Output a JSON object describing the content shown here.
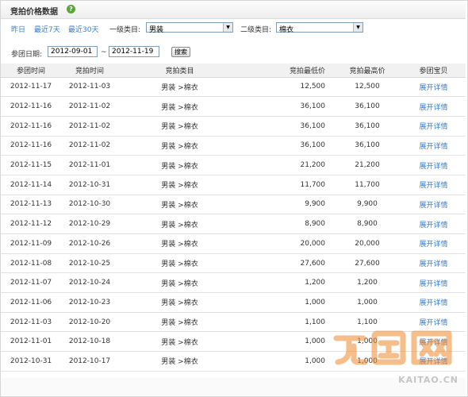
{
  "header": {
    "title": "竞拍价格数据",
    "help_icon": "?"
  },
  "filters": {
    "ranges": [
      "昨日",
      "最近7天",
      "最近30天"
    ],
    "level1_label": "一级类目:",
    "level1_value": "男装",
    "level2_label": "二级类目:",
    "level2_value": "棉衣",
    "date_label": "参团日期:",
    "date_from": "2012-09-01",
    "date_sep": "~",
    "date_to": "2012-11-19",
    "search_label": "搜索"
  },
  "table": {
    "columns": [
      "参团时间",
      "竞拍时间",
      "竞拍类目",
      "竞拍最低价",
      "竞拍最高价",
      "参团宝贝"
    ],
    "rows": [
      [
        "2012-11-17",
        "2012-11-03",
        "男装 >棉衣",
        "12,500",
        "12,500",
        "展开详情"
      ],
      [
        "2012-11-16",
        "2012-11-02",
        "男装 >棉衣",
        "36,100",
        "36,100",
        "展开详情"
      ],
      [
        "2012-11-16",
        "2012-11-02",
        "男装 >棉衣",
        "36,100",
        "36,100",
        "展开详情"
      ],
      [
        "2012-11-16",
        "2012-11-02",
        "男装 >棉衣",
        "36,100",
        "36,100",
        "展开详情"
      ],
      [
        "2012-11-15",
        "2012-11-01",
        "男装 >棉衣",
        "21,200",
        "21,200",
        "展开详情"
      ],
      [
        "2012-11-14",
        "2012-10-31",
        "男装 >棉衣",
        "11,700",
        "11,700",
        "展开详情"
      ],
      [
        "2012-11-13",
        "2012-10-30",
        "男装 >棉衣",
        "9,900",
        "9,900",
        "展开详情"
      ],
      [
        "2012-11-12",
        "2012-10-29",
        "男装 >棉衣",
        "8,900",
        "8,900",
        "展开详情"
      ],
      [
        "2012-11-09",
        "2012-10-26",
        "男装 >棉衣",
        "20,000",
        "20,000",
        "展开详情"
      ],
      [
        "2012-11-08",
        "2012-10-25",
        "男装 >棉衣",
        "27,600",
        "27,600",
        "展开详情"
      ],
      [
        "2012-11-07",
        "2012-10-24",
        "男装 >棉衣",
        "1,200",
        "1,200",
        "展开详情"
      ],
      [
        "2012-11-06",
        "2012-10-23",
        "男装 >棉衣",
        "1,000",
        "1,000",
        "展开详情"
      ],
      [
        "2012-11-03",
        "2012-10-20",
        "男装 >棉衣",
        "1,100",
        "1,100",
        "展开详情"
      ],
      [
        "2012-11-01",
        "2012-10-18",
        "男装 >棉衣",
        "1,000",
        "1,000",
        "展开详情"
      ],
      [
        "2012-10-31",
        "2012-10-17",
        "男装 >棉衣",
        "1,000",
        "1,000",
        "展开详情"
      ]
    ]
  },
  "watermark": {
    "site": "KAITAO.CN",
    "logo_icon": "kaitao-logo"
  },
  "colors": {
    "link": "#3a7ccb",
    "help": "#5aa63a",
    "watermark": "#f08a2c"
  }
}
